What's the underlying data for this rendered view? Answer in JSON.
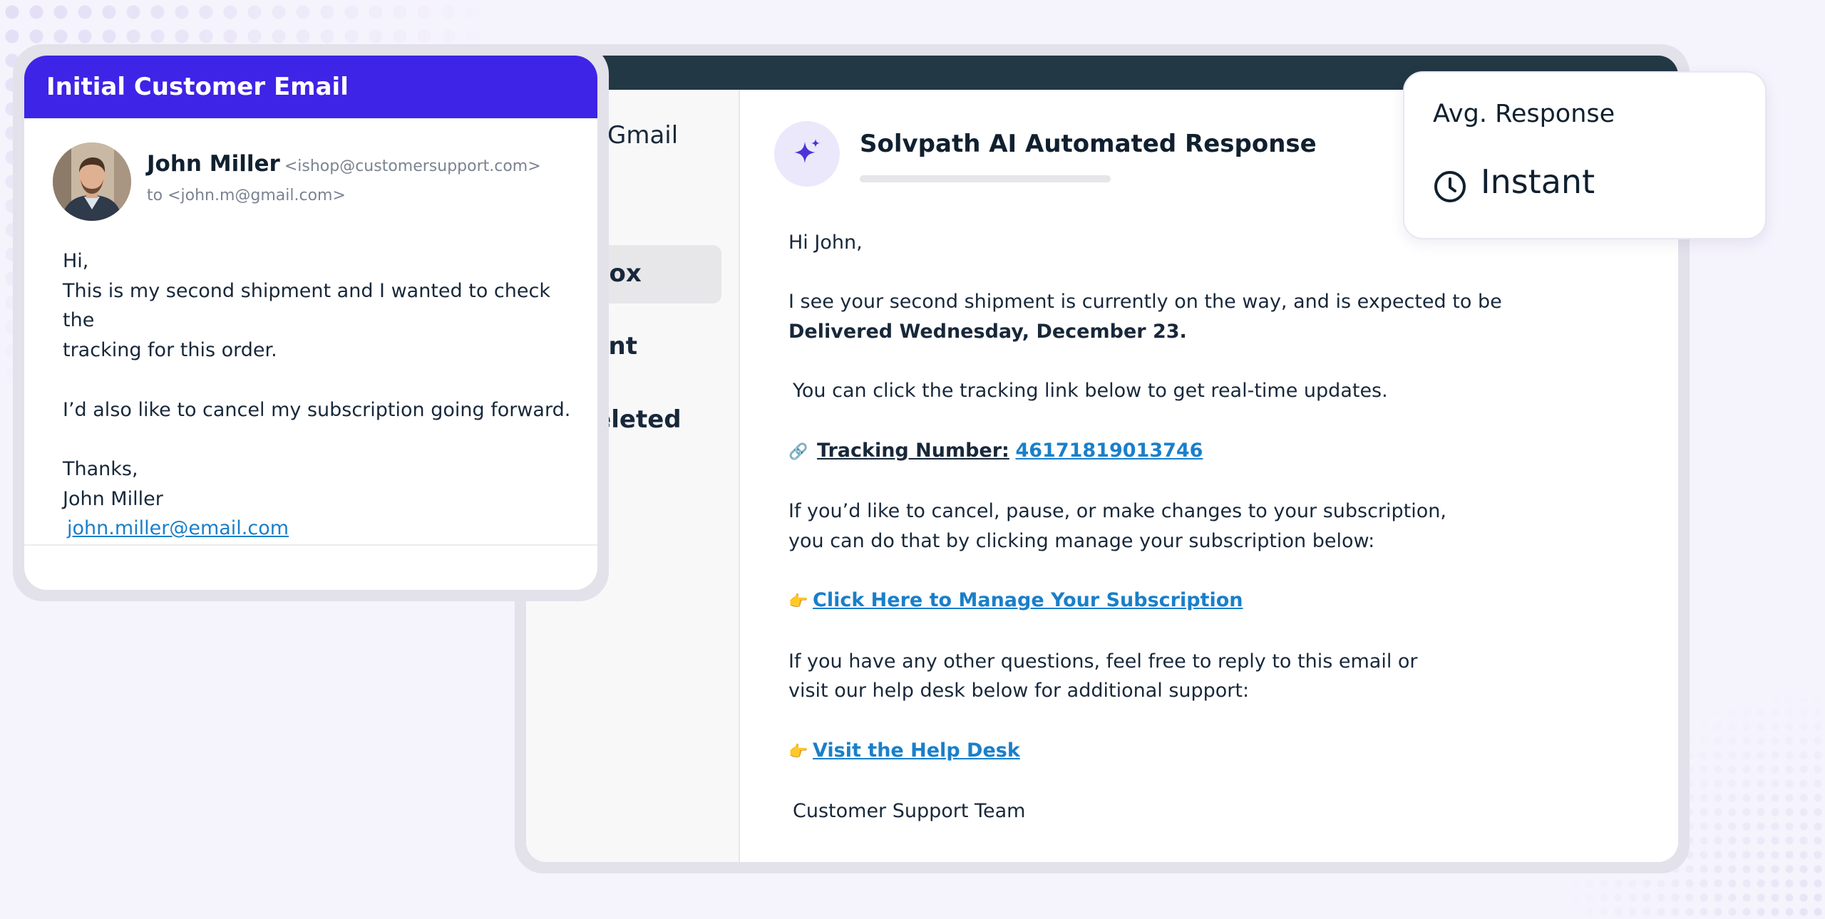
{
  "sidebar": {
    "brand": "Gmail",
    "items": [
      {
        "label": "nbox"
      },
      {
        "label": "Sent"
      },
      {
        "label": "Deleted"
      }
    ]
  },
  "mail": {
    "subject": "Solvpath AI Automated Response",
    "greeting": "Hi John,",
    "p1_line1": "I see your second shipment is currently on the way, and is expected to be",
    "p1_line2": "Delivered Wednesday, December 23.",
    "p2": "You can click the tracking link below to get real-time updates.",
    "tracking_label": "Tracking Number:",
    "tracking_number": "46171819013746",
    "p3_line1": "If you’d like to cancel, pause, or make changes to your subscription,",
    "p3_line2": "you can do that by clicking manage your subscription below:",
    "manage_link": "Click Here to Manage Your Subscription",
    "p4_line1": "If you have any other questions, feel free to reply to this email or",
    "p4_line2": "visit our help desk below for additional support:",
    "helpdesk_link": "Visit the Help Desk",
    "signoff": "Customer Support Team",
    "link_color": "#1a7fc9"
  },
  "stat": {
    "label": "Avg. Response",
    "value": "Instant",
    "icon": "clock-icon"
  },
  "customer_email": {
    "header": "Initial Customer Email",
    "header_color": "#3e24e6",
    "from_name": "John Miller",
    "from_address": "<ishop@customersupport.com>",
    "to_line": "to <john.m@gmail.com>",
    "greeting": "Hi,",
    "line1": "This is my second shipment and I wanted to check the",
    "line2": "tracking for this order.",
    "line3": "I’d also like to cancel my subscription going forward.",
    "thanks": "Thanks,",
    "signature_name": "John Miller",
    "signature_email": "john.miller@email.com"
  }
}
